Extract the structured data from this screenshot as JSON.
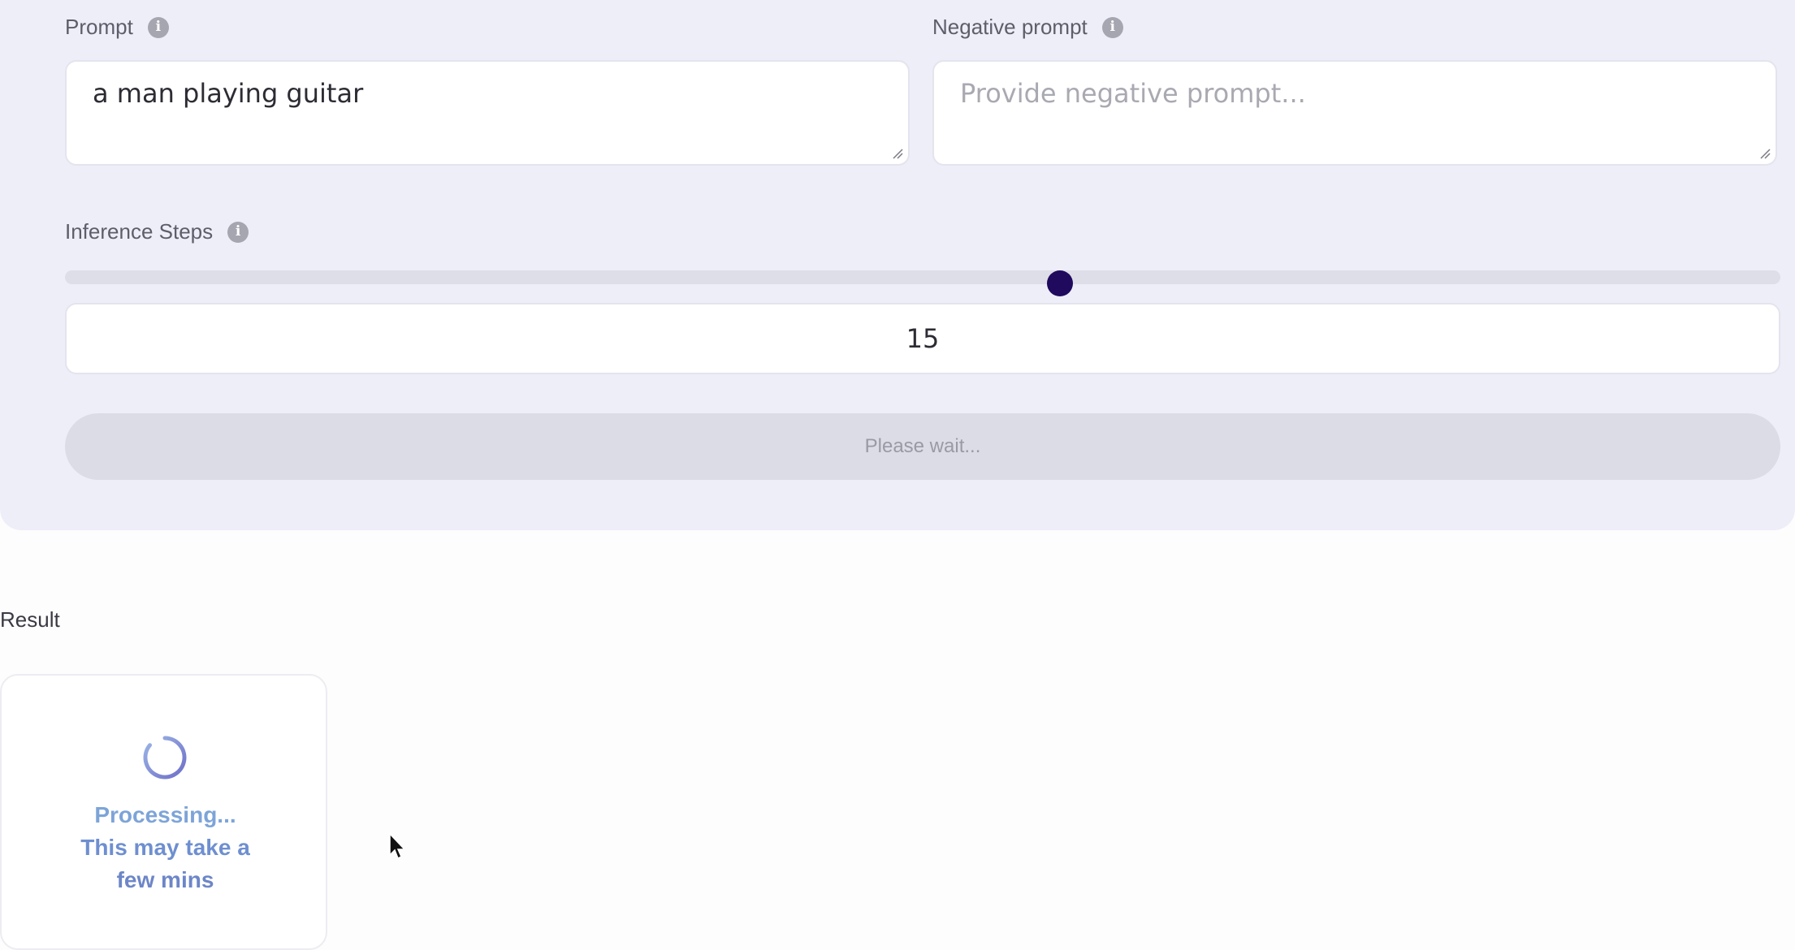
{
  "form": {
    "prompt": {
      "label": "Prompt",
      "value": "a man playing guitar"
    },
    "negative_prompt": {
      "label": "Negative prompt",
      "placeholder": "Provide negative prompt..."
    },
    "inference_steps": {
      "label": "Inference Steps",
      "value": "15",
      "slider_fraction": 0.58
    },
    "submit_button_label": "Please wait..."
  },
  "result": {
    "label": "Result",
    "status_line1": "Processing...",
    "status_line2": "This may take a",
    "status_line3": "few mins"
  },
  "colors": {
    "panel_background": "#eeeef9",
    "slider_thumb": "#1f0a5e",
    "processing_text": "#7da4d8"
  }
}
